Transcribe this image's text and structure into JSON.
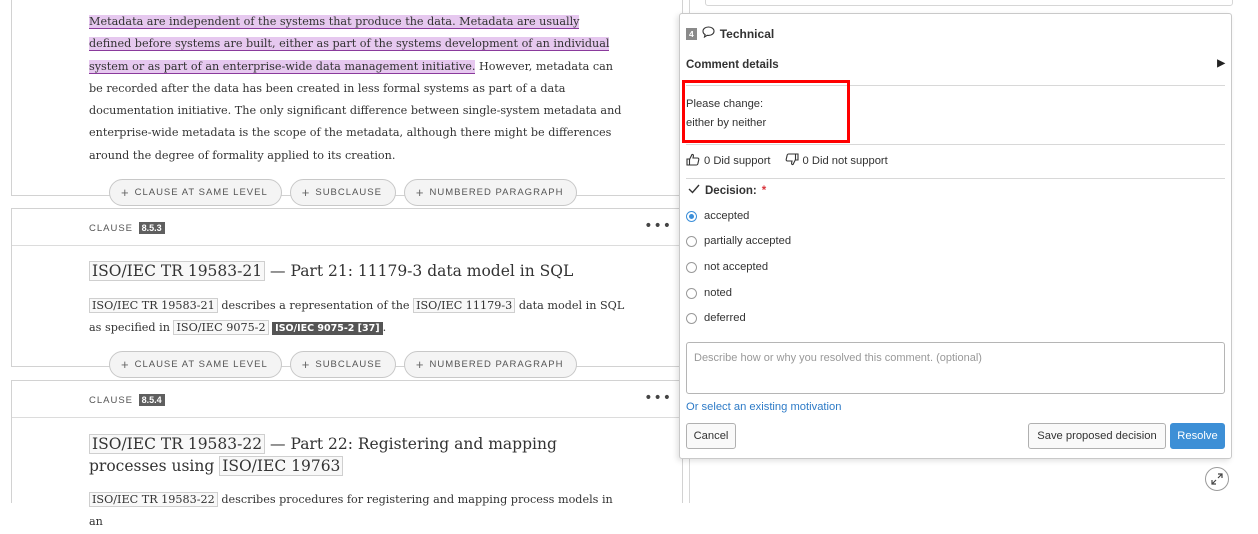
{
  "clause1": {
    "para_highlight": "Metadata are independent of the systems that produce the data. Metadata are usually defined before systems are built, either as part of the systems development of an individual system or as part of an enterprise-wide data management initiative.",
    "para_rest": " However, metadata can be recorded after the data has been created in less formal systems as part of a data documentation initiative. The only significant difference between single-system metadata and enterprise-wide metadata is the scope of the metadata, although there might be differences around the degree of formality applied to its creation."
  },
  "actions": {
    "clause_same_level": "CLAUSE AT SAME LEVEL",
    "subclause": "SUBCLAUSE",
    "numbered_paragraph": "NUMBERED PARAGRAPH"
  },
  "clause2": {
    "label": "CLAUSE",
    "number": "8.5.3",
    "title_ref": "ISO/IEC TR 19583-21",
    "title_rest": " — Part 21: 11179-3 data model in SQL",
    "body_ref1": "ISO/IEC TR 19583-21",
    "body_t1": " describes a representation of the ",
    "body_ref2": "ISO/IEC 11179-3",
    "body_t2": " data model in SQL as specified in ",
    "body_ref3": "ISO/IEC 9075-2",
    "body_bib": "ISO/IEC 9075-2 [37]",
    "body_t3": "."
  },
  "clause3": {
    "label": "CLAUSE",
    "number": "8.5.4",
    "title_ref1": "ISO/IEC TR 19583-22",
    "title_t1": " — Part 22: Registering and mapping processes using ",
    "title_ref2": "ISO/IEC 19763",
    "body_ref": "ISO/IEC TR 19583-22",
    "body_t": " describes procedures for registering and mapping process models in an"
  },
  "comment": {
    "number": "4",
    "type": "Technical",
    "details_label": "Comment details",
    "text_line1": "Please change:",
    "text_line2": "either by neither",
    "did_support": "0 Did support",
    "did_not_support": "0 Did not support",
    "decision_label": "Decision:",
    "required_mark": "*",
    "options": [
      "accepted",
      "partially accepted",
      "not accepted",
      "noted",
      "deferred"
    ],
    "selected": "accepted",
    "motivation_placeholder": "Describe how or why you resolved this comment. (optional)",
    "existing_motivation_link": "Or select an existing motivation",
    "cancel_label": "Cancel",
    "save_label": "Save proposed decision",
    "resolve_label": "Resolve"
  },
  "colors": {
    "highlight": "#e6c8ef",
    "accent": "#3d8fd6",
    "required": "#d9363e",
    "annotation": "#ff0000"
  }
}
